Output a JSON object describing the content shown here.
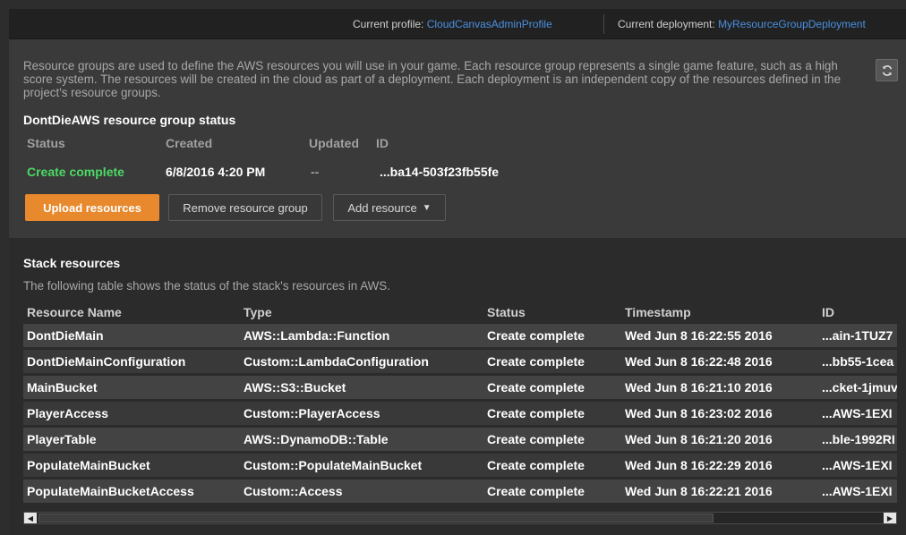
{
  "topbar": {
    "profile_label": "Current profile: ",
    "profile_value": "CloudCanvasAdminProfile",
    "deployment_label": "Current deployment: ",
    "deployment_value": "MyResourceGroupDeployment"
  },
  "description": "Resource groups are used to define the AWS resources you will use in your game. Each resource group represents a single game feature, such as a high score system. The resources will be created in the cloud as part of a deployment. Each deployment is an independent copy of the resources defined in the project's resource groups.",
  "resource_group": {
    "title": "DontDieAWS resource group status",
    "headers": {
      "status": "Status",
      "created": "Created",
      "updated": "Updated",
      "id": "ID"
    },
    "values": {
      "status": "Create complete",
      "created": "6/8/2016 4:20 PM",
      "updated": "--",
      "id": "...ba14-503f23fb55fe"
    }
  },
  "buttons": {
    "upload": "Upload resources",
    "remove": "Remove resource group",
    "add": "Add resource"
  },
  "stack": {
    "title": "Stack resources",
    "subtitle": "The following table shows the status of the stack's resources in AWS.",
    "columns": [
      "Resource Name",
      "Type",
      "Status",
      "Timestamp",
      "ID"
    ],
    "rows": [
      [
        "DontDieMain",
        "AWS::Lambda::Function",
        "Create complete",
        "Wed Jun 8 16:22:55 2016",
        "...ain-1TUZ7"
      ],
      [
        "DontDieMainConfiguration",
        "Custom::LambdaConfiguration",
        "Create complete",
        "Wed Jun 8 16:22:48 2016",
        "...bb55-1cea"
      ],
      [
        "MainBucket",
        "AWS::S3::Bucket",
        "Create complete",
        "Wed Jun 8 16:21:10 2016",
        "...cket-1jmuv"
      ],
      [
        "PlayerAccess",
        "Custom::PlayerAccess",
        "Create complete",
        "Wed Jun 8 16:23:02 2016",
        "...AWS-1EXI"
      ],
      [
        "PlayerTable",
        "AWS::DynamoDB::Table",
        "Create complete",
        "Wed Jun 8 16:21:20 2016",
        "...ble-1992RI"
      ],
      [
        "PopulateMainBucket",
        "Custom::PopulateMainBucket",
        "Create complete",
        "Wed Jun 8 16:22:29 2016",
        "...AWS-1EXI"
      ],
      [
        "PopulateMainBucketAccess",
        "Custom::Access",
        "Create complete",
        "Wed Jun 8 16:22:21 2016",
        "...AWS-1EXI"
      ]
    ]
  },
  "colors": {
    "accent_orange": "#e8892d",
    "status_green": "#4cd964",
    "link_blue": "#4a90e2"
  },
  "icons": {
    "refresh": "refresh-icon",
    "dropdown": "caret-down-icon",
    "scroll_left": "arrow-left-icon",
    "scroll_right": "arrow-right-icon"
  }
}
